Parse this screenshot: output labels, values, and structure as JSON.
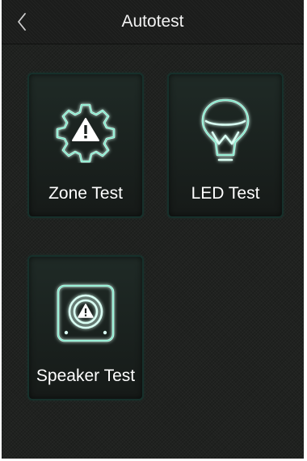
{
  "header": {
    "title": "Autotest",
    "back_icon": "chevron-left-icon"
  },
  "tiles": [
    {
      "label": "Zone Test",
      "icon": "gear-warning-icon"
    },
    {
      "label": "LED Test",
      "icon": "bulb-icon"
    },
    {
      "label": "Speaker Test",
      "icon": "speaker-warning-icon"
    }
  ],
  "colors": {
    "background": "#202220",
    "tile_border": "#16302b",
    "icon_glow": "#2fd3a6",
    "text": "#ffffff"
  }
}
